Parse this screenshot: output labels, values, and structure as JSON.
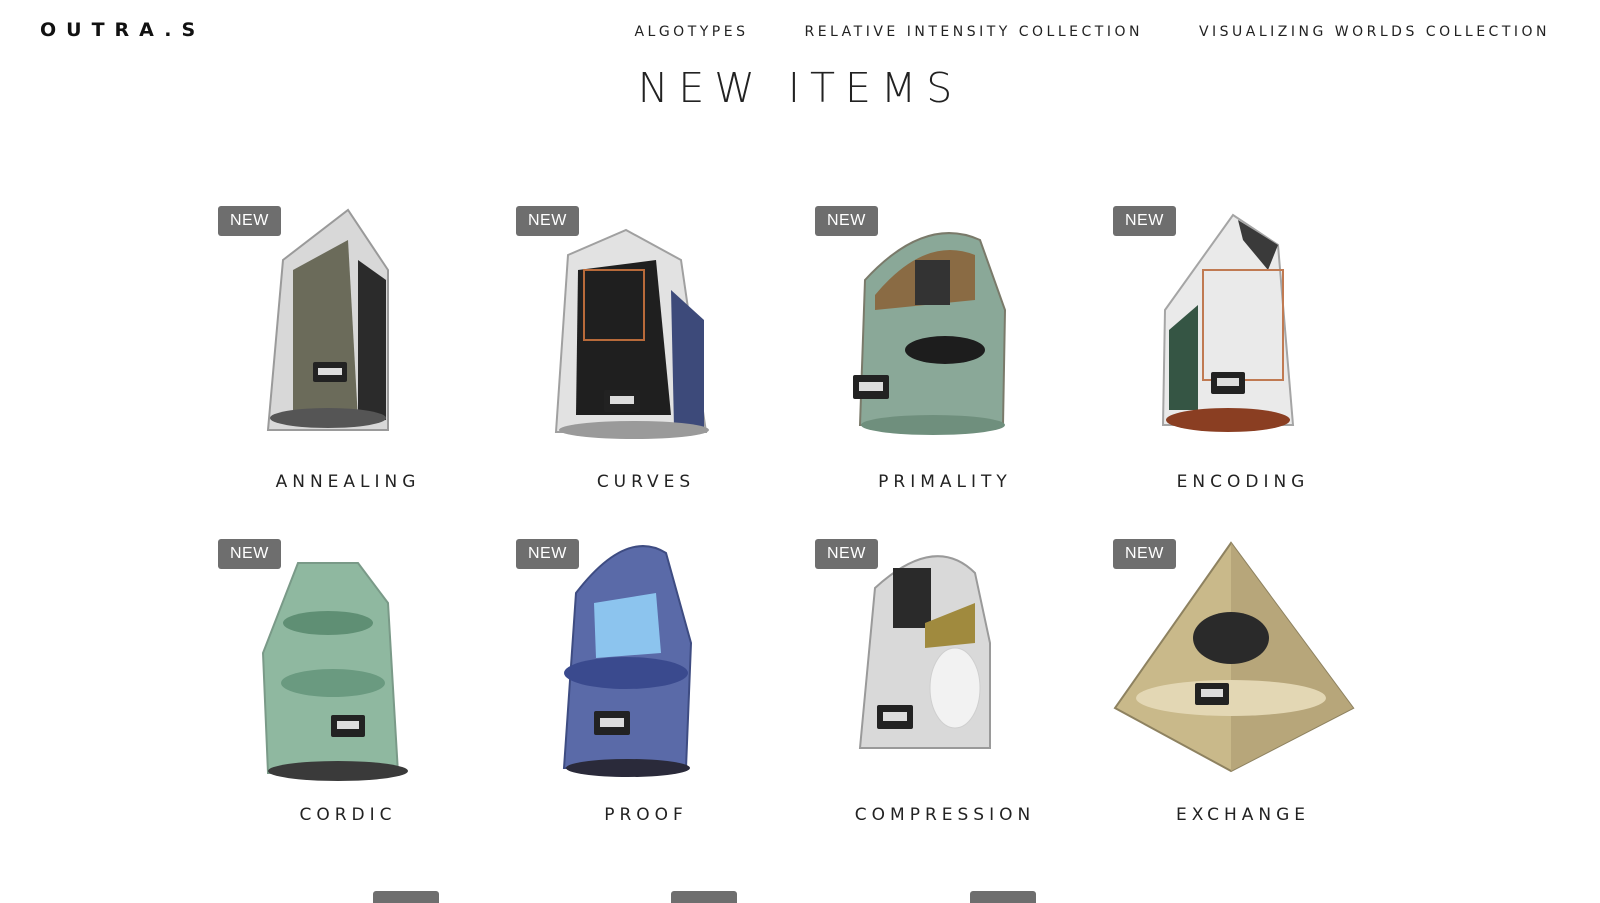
{
  "header": {
    "logo": "OUTRA.S",
    "nav": [
      "ALGOTYPES",
      "RELATIVE INTENSITY COLLECTION",
      "VISUALIZING WORLDS COLLECTION"
    ]
  },
  "main": {
    "title": "NEW ITEMS",
    "badge_label": "NEW",
    "products": [
      {
        "name": "ANNEALING",
        "icon": "crystal-obelisk-icon"
      },
      {
        "name": "CURVES",
        "icon": "crystal-tower-icon"
      },
      {
        "name": "PRIMALITY",
        "icon": "crystal-dome-icon"
      },
      {
        "name": "ENCODING",
        "icon": "crystal-tower-icon"
      },
      {
        "name": "CORDIC",
        "icon": "crystal-tower-icon"
      },
      {
        "name": "PROOF",
        "icon": "crystal-obelisk-icon"
      },
      {
        "name": "COMPRESSION",
        "icon": "crystal-dome-icon"
      },
      {
        "name": "EXCHANGE",
        "icon": "crystal-pyramid-icon"
      }
    ]
  },
  "colors": {
    "badge_bg": "#6e6e6e",
    "text": "#222222",
    "background": "#ffffff"
  }
}
